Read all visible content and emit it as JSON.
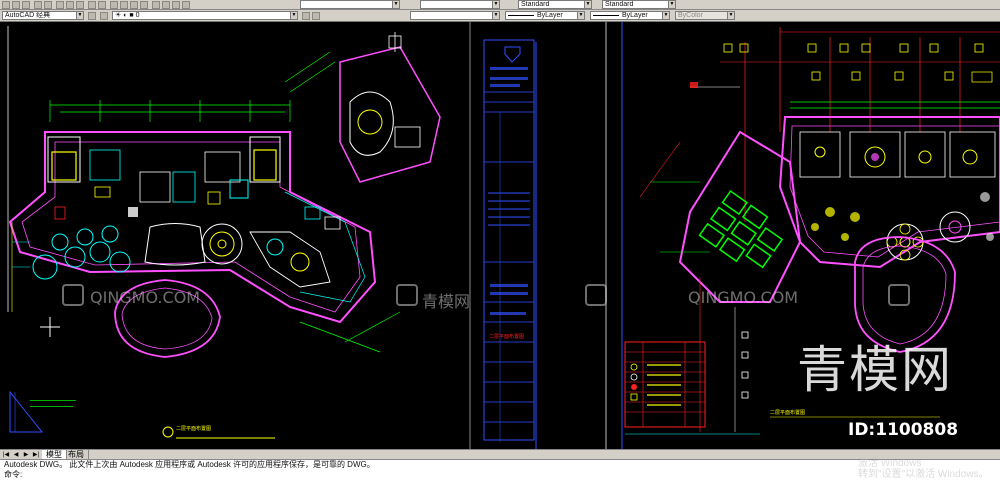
{
  "toolbar": {
    "workspace": "AutoCAD 经典",
    "layer_value": "0",
    "style_standard_1": "Standard",
    "style_standard_2": "Standard",
    "linetype": "ByLayer",
    "lineweight": "ByLayer",
    "plotstyle": "ByColor"
  },
  "drawing": {
    "title_left": "二层平面布置图",
    "title_right": "二层平面布置图",
    "title_bar_label": "二层平面布置图"
  },
  "tabs": [
    "模型",
    "布局"
  ],
  "command": {
    "line1": "Autodesk DWG。  此文件上次由 Autodesk 应用程序或 Autodesk 许可的应用程序保存，是可靠的 DWG。",
    "prompt": "命令:"
  },
  "watermarks": {
    "site_latin": "QINGMO.COM",
    "site_cn": "青模网",
    "big_cn": "青模网",
    "id_text": "ID:1100808"
  },
  "os_notice": {
    "line1": "激活 Windows",
    "line2": "转到\"设置\"以激活 Windows。"
  },
  "colors": {
    "cad_background": "#000000",
    "wall_magenta": "#ff50ff",
    "cyan": "#00ffff",
    "yellow": "#ffff00",
    "green": "#00ff00",
    "red": "#ff2020",
    "blue": "#3050ff",
    "toolbar_grey": "#d4d0c8"
  }
}
